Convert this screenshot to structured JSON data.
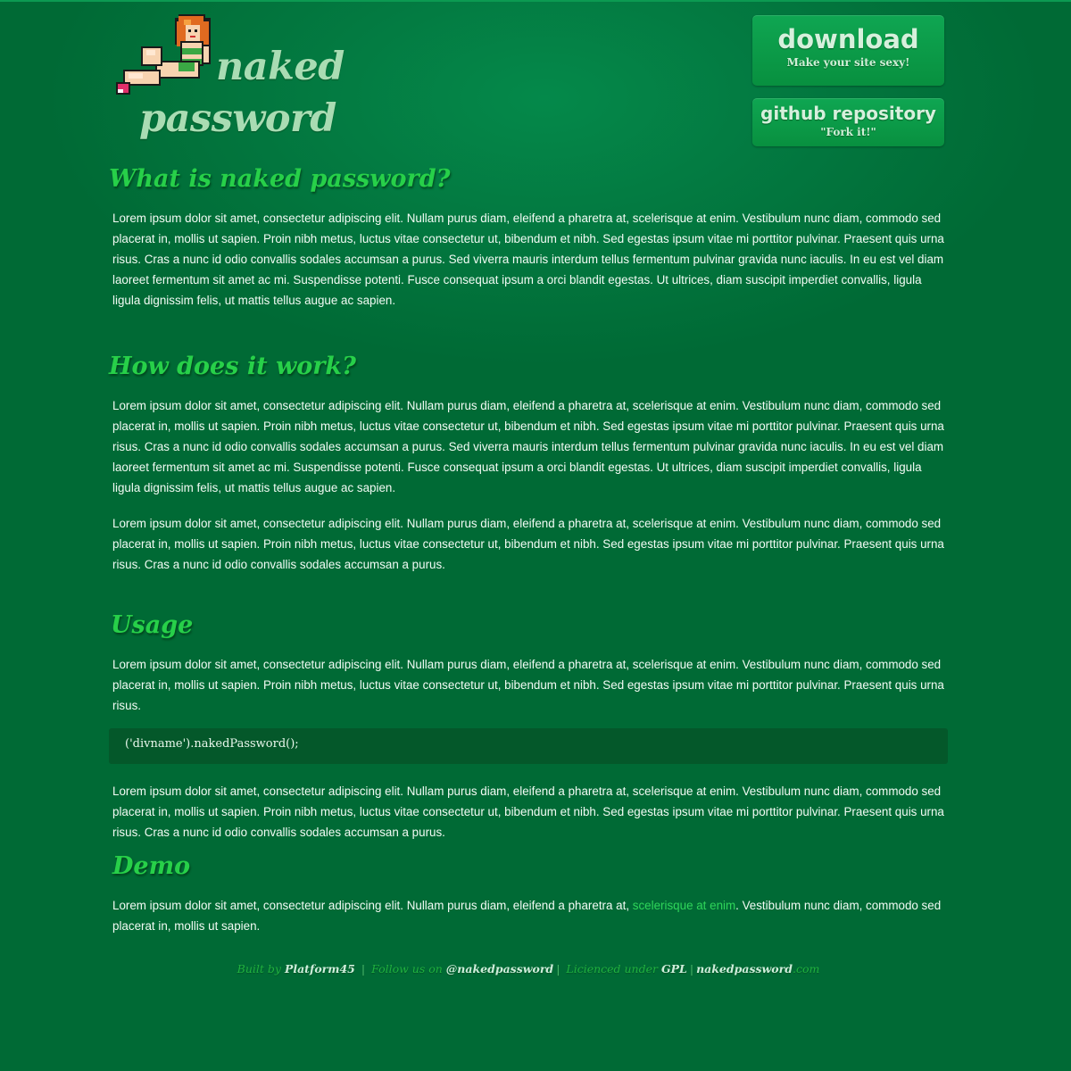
{
  "header": {
    "logo_line1": "naked",
    "logo_line2": "password",
    "download": {
      "title": "download",
      "subtitle": "Make your site sexy!"
    },
    "github": {
      "title": "github repository",
      "subtitle": "\"Fork it!\""
    }
  },
  "sections": {
    "what": {
      "heading": "What is naked password?",
      "p1": "Lorem ipsum dolor sit amet, consectetur adipiscing elit. Nullam purus diam, eleifend a pharetra at, scelerisque at enim. Vestibulum nunc diam, commodo sed placerat in, mollis ut sapien. Proin nibh metus, luctus vitae consectetur ut, bibendum et nibh. Sed egestas ipsum vitae mi porttitor pulvinar. Praesent quis urna risus. Cras a nunc id odio convallis sodales accumsan a purus. Sed viverra mauris interdum tellus fermentum pulvinar gravida nunc iaculis. In eu est vel diam laoreet fermentum sit amet ac mi. Suspendisse potenti. Fusce consequat ipsum a orci blandit egestas. Ut ultrices, diam suscipit imperdiet convallis, ligula ligula dignissim felis, ut mattis tellus augue ac sapien."
    },
    "how": {
      "heading": "How does it work?",
      "p1": "Lorem ipsum dolor sit amet, consectetur adipiscing elit. Nullam purus diam, eleifend a pharetra at, scelerisque at enim. Vestibulum nunc diam, commodo sed placerat in, mollis ut sapien. Proin nibh metus, luctus vitae consectetur ut, bibendum et nibh. Sed egestas ipsum vitae mi porttitor pulvinar. Praesent quis urna risus. Cras a nunc id odio convallis sodales accumsan a purus. Sed viverra mauris interdum tellus fermentum pulvinar gravida nunc iaculis. In eu est vel diam laoreet fermentum sit amet ac mi. Suspendisse potenti. Fusce consequat ipsum a orci blandit egestas. Ut ultrices, diam suscipit imperdiet convallis, ligula ligula dignissim felis, ut mattis tellus augue ac sapien.",
      "p2": "Lorem ipsum dolor sit amet, consectetur adipiscing elit. Nullam purus diam, eleifend a pharetra at, scelerisque at enim. Vestibulum nunc diam, commodo sed placerat in, mollis ut sapien. Proin nibh metus, luctus vitae consectetur ut, bibendum et nibh. Sed egestas ipsum vitae mi porttitor pulvinar. Praesent quis urna risus. Cras a nunc id odio convallis sodales accumsan a purus."
    },
    "usage": {
      "heading": "Usage",
      "p1": "Lorem ipsum dolor sit amet, consectetur adipiscing elit. Nullam purus diam, eleifend a pharetra at, scelerisque at enim. Vestibulum nunc diam, commodo sed placerat in, mollis ut sapien. Proin nibh metus, luctus vitae consectetur ut, bibendum et nibh. Sed egestas ipsum vitae mi porttitor pulvinar. Praesent quis urna risus.",
      "code": "('divname').nakedPassword();",
      "p2": "Lorem ipsum dolor sit amet, consectetur adipiscing elit. Nullam purus diam, eleifend a pharetra at, scelerisque at enim. Vestibulum nunc diam, commodo sed placerat in, mollis ut sapien. Proin nibh metus, luctus vitae consectetur ut, bibendum et nibh. Sed egestas ipsum vitae mi porttitor pulvinar. Praesent quis urna risus. Cras a nunc id odio convallis sodales accumsan a purus."
    },
    "demo": {
      "heading": "Demo",
      "p1_before": "Lorem ipsum dolor sit amet, consectetur adipiscing elit. Nullam purus diam, eleifend a pharetra at, ",
      "p1_link": "scelerisque at enim",
      "p1_after": ". Vestibulum nunc diam, commodo sed placerat in, mollis ut sapien."
    }
  },
  "footer": {
    "built_by": "Built by",
    "platform": "Platform45",
    "follow": "Follow us on",
    "twitter": "@nakedpassword",
    "licenced": "Licienced under",
    "license": "GPL",
    "site": "nakedpassword",
    "tld": ".com",
    "separator": "|"
  },
  "colors": {
    "background": "#006a35",
    "heading": "#27d049",
    "logo_text": "#a9dcb3",
    "button": "#0a9a48",
    "code_bg": "#04582a",
    "link": "#2fd65a"
  }
}
